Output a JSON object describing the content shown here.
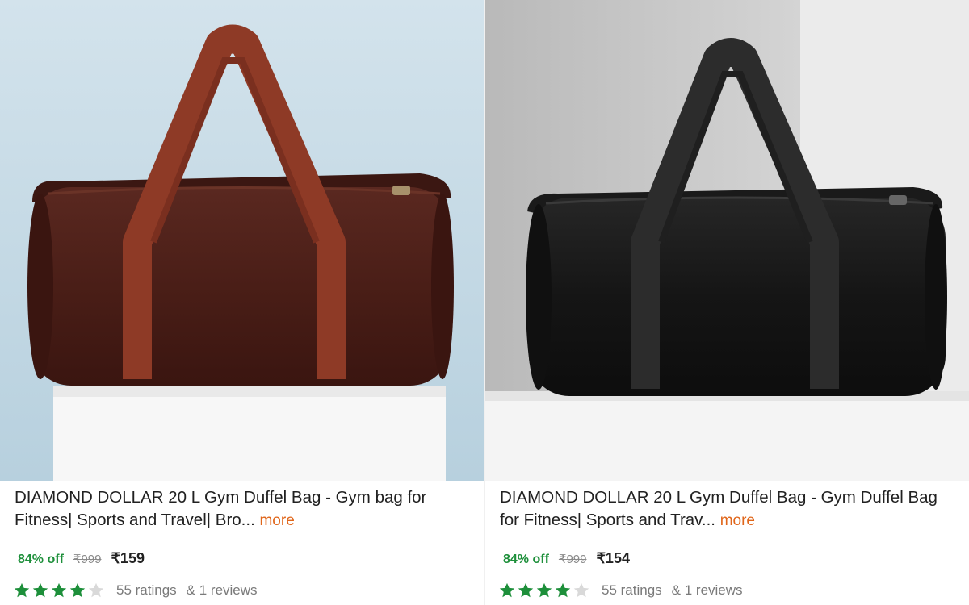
{
  "products": [
    {
      "title": "DIAMOND DOLLAR 20 L Gym Duffel Bag - Gym bag for Fitness| Sports and Travel| Bro...",
      "more_label": "more",
      "discount": "84% off",
      "mrp": "₹999",
      "price": "₹159",
      "rating_stars": 4,
      "ratings_text": "55 ratings",
      "reviews_text": "& 1 reviews",
      "bag_color": "#4a1e17",
      "handle_color": "#8e3a26",
      "photo_background": "#c5dbe6"
    },
    {
      "title": "DIAMOND DOLLAR 20 L Gym Duffel Bag - Gym Duffel Bag for Fitness| Sports and Trav...",
      "more_label": "more",
      "discount": "84% off",
      "mrp": "₹999",
      "price": "₹154",
      "rating_stars": 4,
      "ratings_text": "55 ratings",
      "reviews_text": "& 1 reviews",
      "bag_color": "#141414",
      "handle_color": "#2c2c2c",
      "photo_background": "#cdcdcd"
    }
  ],
  "colors": {
    "star_filled": "#1d8f3a",
    "star_empty": "#d9d9d9",
    "discount_green": "#1d8f3a",
    "more_link": "#e0661b"
  }
}
